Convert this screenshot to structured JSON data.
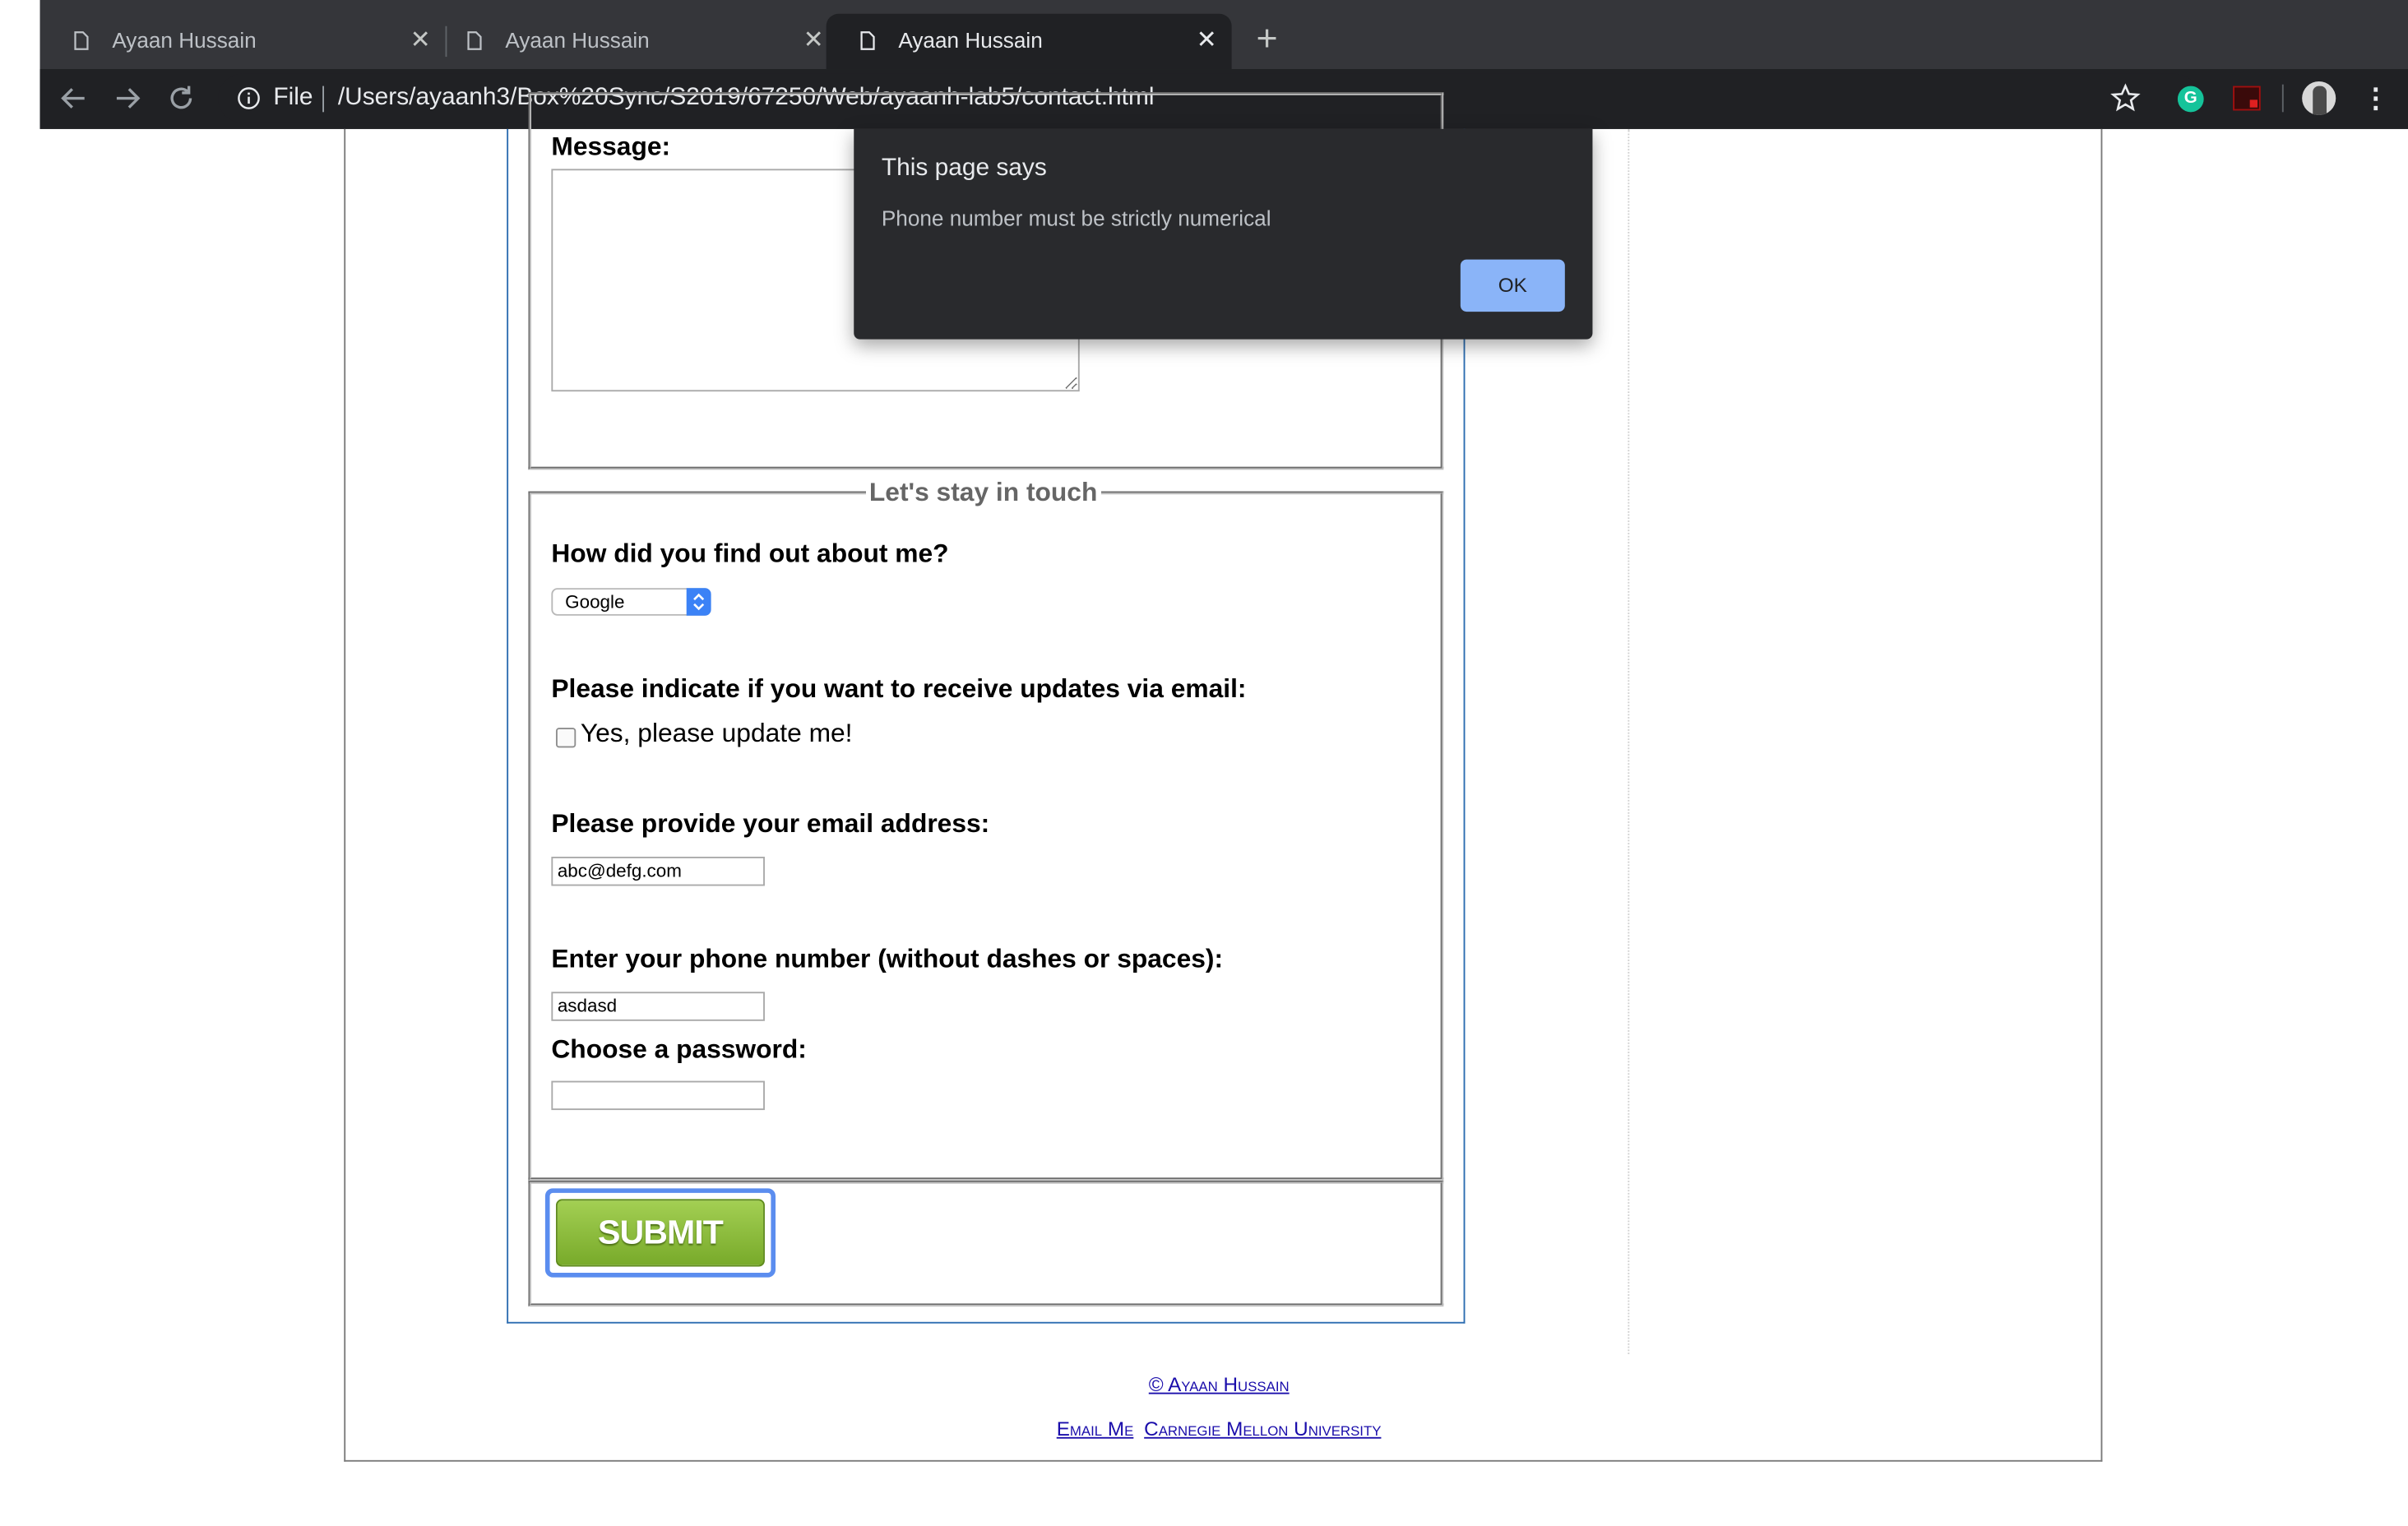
{
  "browser": {
    "tabs": [
      {
        "title": "Ayaan Hussain",
        "active": false
      },
      {
        "title": "Ayaan Hussain",
        "active": false
      },
      {
        "title": "Ayaan Hussain",
        "active": true
      }
    ],
    "new_tab_icon": "plus-icon",
    "scheme_label": "File",
    "url": "/Users/ayaanh3/Box%20Sync/S2019/67250/Web/ayaanh-lab5/contact.html"
  },
  "form": {
    "message_label": "Message:",
    "message_value": "",
    "stay_in_touch_legend": "Let's stay in touch",
    "referral_question": "How did you find out about me?",
    "referral_selected": "Google",
    "updates_question": "Please indicate if you want to receive updates via email:",
    "updates_checkbox_label": "Yes, please update me!",
    "updates_checked": false,
    "email_label": "Please provide your email address:",
    "email_value": "abc@defg.com",
    "phone_label": "Enter your phone number (without dashes or spaces):",
    "phone_value": "asdasd",
    "password_label": "Choose a password:",
    "password_value": "",
    "submit_label": "SUBMIT"
  },
  "footer": {
    "copyright": "© Ayaan Hussain",
    "email_me": "Email Me",
    "university": "Carnegie Mellon University"
  },
  "dialog": {
    "title": "This page says",
    "message": "Phone number must be strictly numerical",
    "ok_label": "OK"
  },
  "colors": {
    "chrome_bg": "#35363a",
    "toolbar_bg": "#202124",
    "dialog_bg": "#292a2d",
    "dialog_ok": "#8ab4f8",
    "submit_green": "#8bbf3d",
    "link": "#1a0dab"
  }
}
